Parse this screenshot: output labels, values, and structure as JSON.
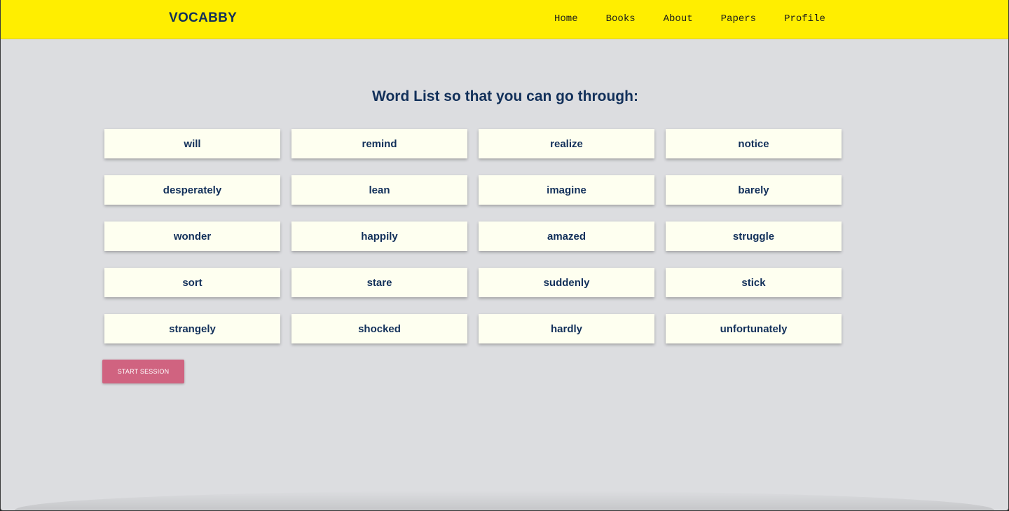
{
  "navbar": {
    "brand": "VOCABBY",
    "links": [
      "Home",
      "Books",
      "About",
      "Papers",
      "Profile"
    ]
  },
  "main": {
    "heading": "Word List so that you can go through:",
    "words": [
      "will",
      "remind",
      "realize",
      "notice",
      "desperately",
      "lean",
      "imagine",
      "barely",
      "wonder",
      "happily",
      "amazed",
      "struggle",
      "sort",
      "stare",
      "suddenly",
      "stick",
      "strangely",
      "shocked",
      "hardly",
      "unfortunately"
    ],
    "start_button_label": "START SESSION"
  },
  "colors": {
    "navbar_bg": "#ffee00",
    "page_bg": "#dcdde0",
    "card_bg": "#fefff0",
    "text_dark_blue": "#12305a",
    "button_bg": "#d06380"
  }
}
